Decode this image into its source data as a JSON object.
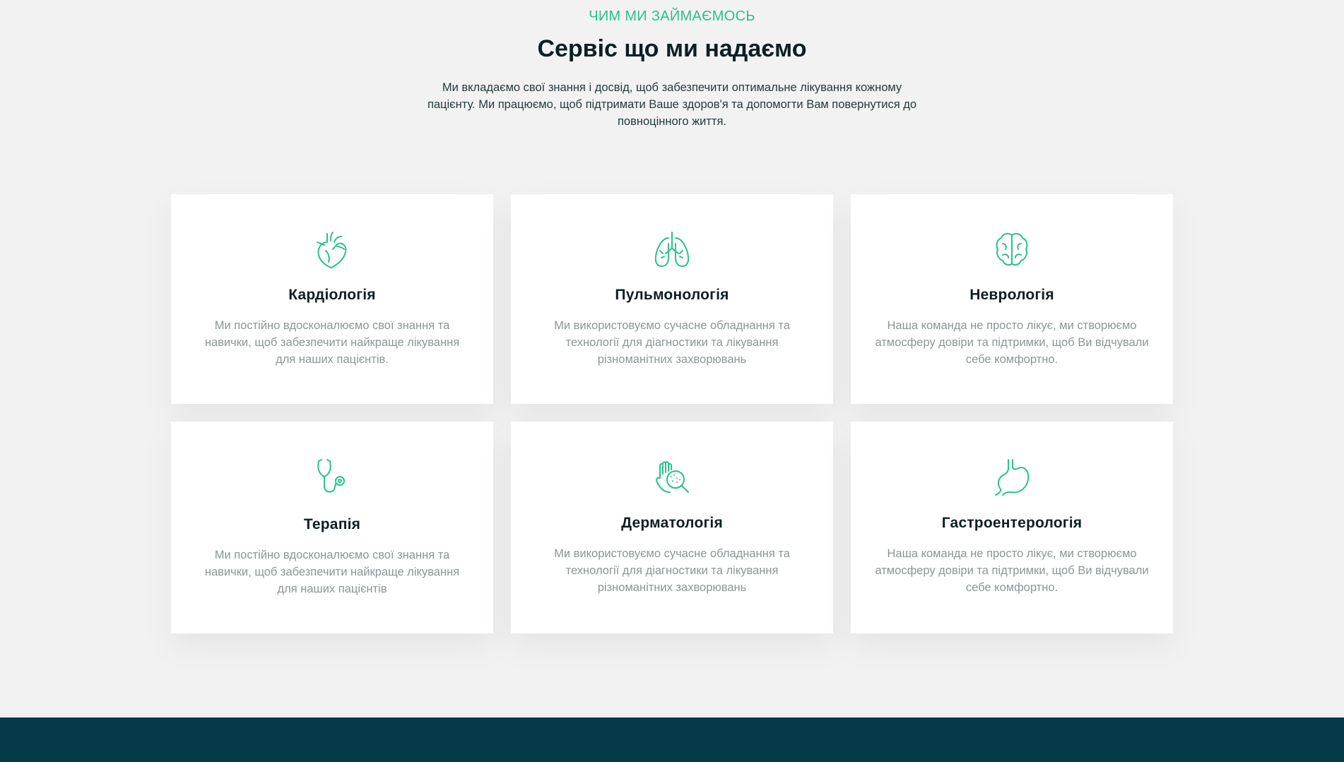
{
  "section": {
    "eyebrow": "ЧИМ МИ ЗАЙМАЄМОСЬ",
    "title": "Сервіс що ми надаємо",
    "intro": "Ми вкладаємо свої знання і досвід, щоб забезпечити оптимальне лікування кожному пацієнту. Ми працюємо, щоб підтримати Ваше здоров'я та допомогти Вам повернутися до повноцінного життя."
  },
  "colors": {
    "accent": "#2bbf8f",
    "background": "#f2f2f2",
    "card": "#ffffff",
    "footer": "#053a48",
    "title_text": "#0d1f22",
    "muted_text": "#8d9596"
  },
  "services": [
    {
      "icon": "heart-icon",
      "title": "Кардіологія",
      "text": "Ми постійно вдосконалюємо свої знання та навички, щоб забезпечити найкраще лікування для наших пацієнтів."
    },
    {
      "icon": "lungs-icon",
      "title": "Пульмонологія",
      "text": "Ми використовуємо сучасне обладнання та технології для діагностики та лікування різноманітних захворювань"
    },
    {
      "icon": "brain-icon",
      "title": "Неврологія",
      "text": "Наша команда не просто лікує, ми створюємо атмосферу довіри та підтримки, щоб Ви відчували себе комфортно."
    },
    {
      "icon": "stethoscope-icon",
      "title": "Терапія",
      "text": "Ми постійно вдосконалюємо свої знання та навички, щоб забезпечити найкраще лікування для наших пацієнтів"
    },
    {
      "icon": "skin-magnifier-icon",
      "title": "Дерматологія",
      "text": "Ми використовуємо сучасне обладнання та технології для діагностики та лікування різноманітних захворювань"
    },
    {
      "icon": "stomach-icon",
      "title": "Гастроентерологія",
      "text": "Наша команда не просто лікує, ми створюємо атмосферу довіри та підтримки, щоб Ви відчували себе комфортно."
    }
  ]
}
